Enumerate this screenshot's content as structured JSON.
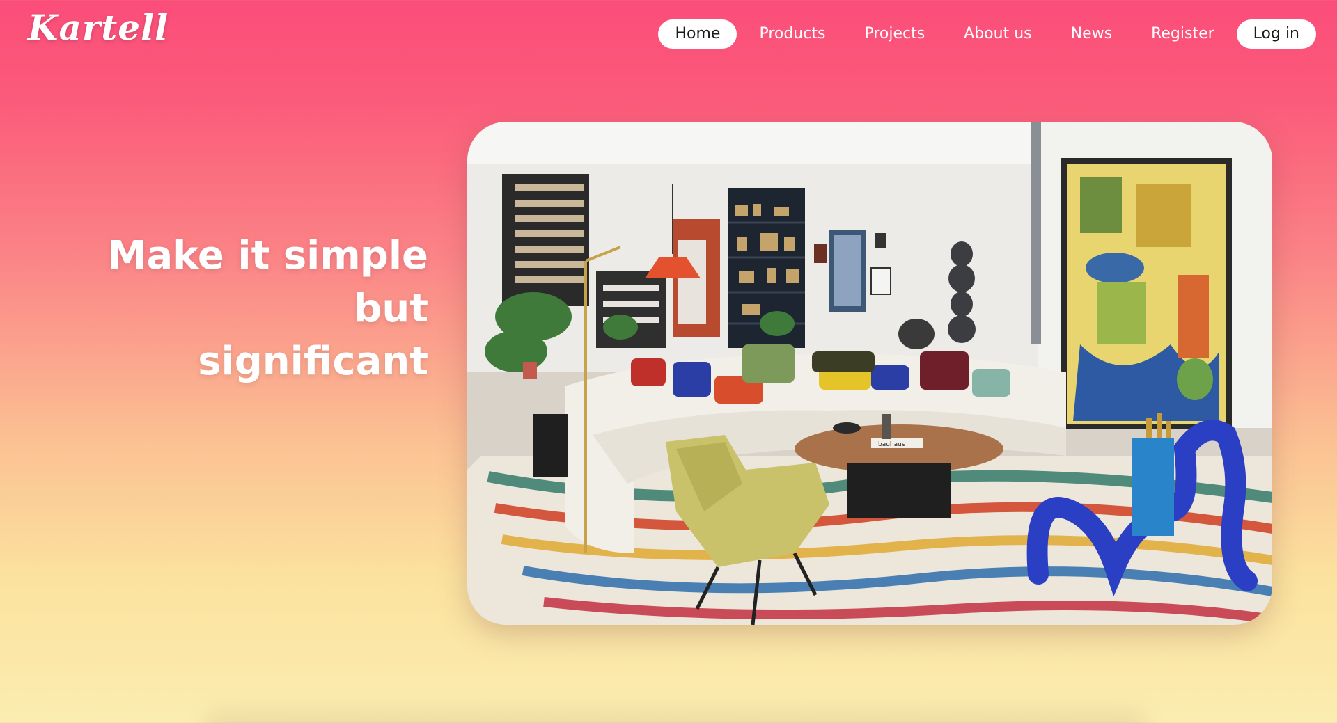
{
  "brand": {
    "logo_text": "Kartell"
  },
  "nav": {
    "items": [
      {
        "label": "Home",
        "active": true
      },
      {
        "label": "Products"
      },
      {
        "label": "Projects"
      },
      {
        "label": "About us"
      },
      {
        "label": "News"
      },
      {
        "label": "Register"
      },
      {
        "label": "Log in"
      }
    ]
  },
  "hero": {
    "heading_line1": "Make it simple but",
    "heading_line2": "significant",
    "image_alt": "Colorful living room interior with curved white sofa, blue sculptural chair and painted rug",
    "book_label": "bauhaus"
  },
  "colors": {
    "gradient_top": "#fb4d7a",
    "gradient_bottom": "#fbedb0",
    "text_light": "#ffffff",
    "pill_bg": "#ffffff",
    "pill_text": "#1a1a1a"
  }
}
